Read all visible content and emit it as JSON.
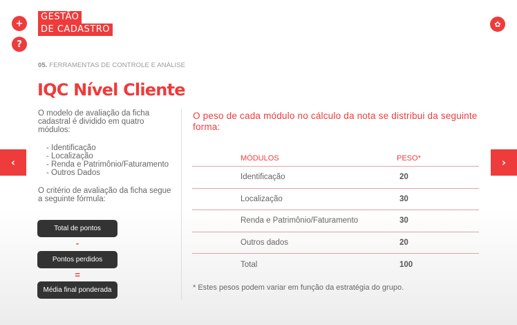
{
  "header": {
    "title_line1": "GESTÃO",
    "title_line2": "DE CADASTRO",
    "plus_label": "+",
    "help_label": "?",
    "star_label": "✿"
  },
  "section": {
    "number": "05.",
    "label": "FERRAMENTAS DE CONTROLE E ANÁLISE"
  },
  "page_title": "IQC Nível Cliente",
  "left": {
    "intro": "O modelo de avaliação da ficha cadastral é dividido em quatro módulos:",
    "modules": [
      "- Identificação",
      "- Localização",
      "- Renda e Patrimônio/Faturamento",
      "- Outros Dados"
    ],
    "criteria": "O critério de avaliação da ficha segue a seguinte fórmula:",
    "formula": {
      "term1": "Total de pontos",
      "op1": "-",
      "term2": "Pontos perdidos",
      "op2": "=",
      "result": "Média final ponderada"
    }
  },
  "right": {
    "intro": "O peso de cada módulo no cálculo da nota se distribui da seguinte forma:",
    "table": {
      "headers": [
        "MÓDULOS",
        "PESO*"
      ],
      "rows": [
        [
          "Identificação",
          "20"
        ],
        [
          "Localização",
          "30"
        ],
        [
          "Renda e Patrimônio/Faturamento",
          "30"
        ],
        [
          "Outros dados",
          "20"
        ],
        [
          "Total",
          "100"
        ]
      ]
    },
    "footnote": "* Estes pesos podem variar em função da estratégia do grupo."
  },
  "nav": {
    "prev": "‹",
    "next": "›"
  },
  "colors": {
    "accent": "#ee3b3b",
    "dark_pill": "#333333"
  }
}
